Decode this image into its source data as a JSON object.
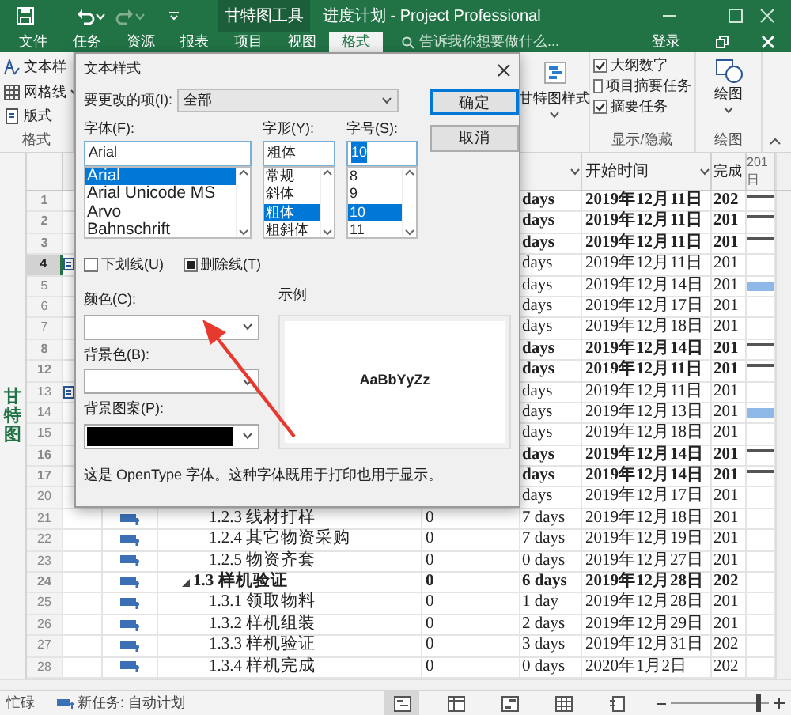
{
  "window": {
    "context_tab": "甘特图工具",
    "title": "进度计划 - Project Professional"
  },
  "ribbon_tabs": [
    {
      "label": "文件",
      "selected": false
    },
    {
      "label": "任务",
      "selected": false
    },
    {
      "label": "资源",
      "selected": false
    },
    {
      "label": "报表",
      "selected": false
    },
    {
      "label": "项目",
      "selected": false
    },
    {
      "label": "视图",
      "selected": false
    },
    {
      "label": "格式",
      "selected": true
    }
  ],
  "tell_me": {
    "placeholder": "告诉我你想要做什么..."
  },
  "sign_in": "登录",
  "ribbon": {
    "format_group": {
      "items": [
        {
          "kind": "text-style",
          "label": "文本样"
        },
        {
          "kind": "gridlines",
          "label": "网格线"
        },
        {
          "kind": "layout",
          "label": "版式"
        }
      ],
      "label": "格式"
    },
    "gantt_style": {
      "label": "甘特图样式"
    },
    "show_hide": {
      "items": [
        {
          "label": "大纲数字",
          "checked": true
        },
        {
          "label": "项目摘要任务",
          "checked": false
        },
        {
          "label": "摘要任务",
          "checked": true
        }
      ],
      "label": "显示/隐藏"
    },
    "drawing": {
      "label": "绘图",
      "group_label": "绘图"
    }
  },
  "side_label": "甘特图",
  "table": {
    "columns": [
      {
        "label": "开始时间"
      },
      {
        "label": "完成"
      }
    ],
    "timescale": {
      "year": "201",
      "day": "日"
    },
    "rows": [
      {
        "id": "1",
        "duration": "days",
        "start": "2019年12月11日",
        "finish": "202",
        "bold": true,
        "selected": false,
        "kind": "summary"
      },
      {
        "id": "2",
        "duration": "days",
        "start": "2019年12月11日",
        "finish": "201",
        "bold": true,
        "selected": false,
        "kind": "summary"
      },
      {
        "id": "3",
        "duration": "days",
        "start": "2019年12月11日",
        "finish": "201",
        "bold": true,
        "selected": false,
        "kind": "summary"
      },
      {
        "id": "4",
        "duration": "days",
        "start": "2019年12月11日",
        "finish": "201",
        "bold": false,
        "selected": true,
        "indicator": true
      },
      {
        "id": "5",
        "duration": "days",
        "start": "2019年12月14日",
        "finish": "201",
        "bold": false,
        "selected": false,
        "kind": "task"
      },
      {
        "id": "6",
        "duration": "days",
        "start": "2019年12月17日",
        "finish": "201",
        "bold": false,
        "selected": false
      },
      {
        "id": "7",
        "duration": "days",
        "start": "2019年12月18日",
        "finish": "201",
        "bold": false,
        "selected": false
      },
      {
        "id": "8",
        "duration": "days",
        "start": "2019年12月14日",
        "finish": "201",
        "bold": true,
        "selected": false,
        "kind": "summary"
      },
      {
        "id": "12",
        "duration": "days",
        "start": "2019年12月11日",
        "finish": "201",
        "bold": true,
        "selected": false,
        "kind": "summary"
      },
      {
        "id": "13",
        "duration": "days",
        "start": "2019年12月11日",
        "finish": "201",
        "bold": false,
        "selected": false,
        "indicator": true
      },
      {
        "id": "14",
        "duration": "days",
        "start": "2019年12月13日",
        "finish": "201",
        "bold": false,
        "selected": false,
        "kind": "task"
      },
      {
        "id": "15",
        "duration": "days",
        "start": "2019年12月18日",
        "finish": "201",
        "bold": false,
        "selected": false
      },
      {
        "id": "16",
        "duration": "days",
        "start": "2019年12月14日",
        "finish": "201",
        "bold": true,
        "selected": false,
        "kind": "summary"
      },
      {
        "id": "17",
        "duration": "days",
        "start": "2019年12月14日",
        "finish": "201",
        "bold": true,
        "selected": false,
        "kind": "summary"
      },
      {
        "id": "20",
        "duration": "days",
        "start": "2019年12月17日",
        "finish": "201",
        "bold": false,
        "selected": false
      },
      {
        "id": "21",
        "name": "1.2.3 线材打样",
        "work": "0",
        "duration": "7 days",
        "start": "2019年12月18日",
        "finish": "201",
        "bold": false,
        "selected": false
      },
      {
        "id": "22",
        "name": "1.2.4 其它物资采购",
        "work": "0",
        "duration": "7 days",
        "start": "2019年12月19日",
        "finish": "201",
        "bold": false,
        "selected": false
      },
      {
        "id": "23",
        "name": "1.2.5 物资齐套",
        "work": "0",
        "duration": "0 days",
        "start": "2019年12月27日",
        "finish": "201",
        "bold": false,
        "selected": false
      },
      {
        "id": "24",
        "name": "1.3 样机验证",
        "work": "0",
        "duration": "6 days",
        "start": "2019年12月28日",
        "finish": "202",
        "bold": true,
        "selected": false,
        "expanded": true,
        "children": [
          {
            "id": "25",
            "name": "1.3.1 领取物料",
            "work": "0",
            "duration": "1 day",
            "start": "2019年12月28日",
            "finish": "201",
            "bold": false,
            "selected": false
          },
          {
            "id": "26",
            "name": "1.3.2 样机组装",
            "work": "0",
            "duration": "2 days",
            "start": "2019年12月29日",
            "finish": "201",
            "bold": false,
            "selected": false
          },
          {
            "id": "27",
            "name": "1.3.3 样机验证",
            "work": "0",
            "duration": "3 days",
            "start": "2019年12月31日",
            "finish": "202",
            "bold": false,
            "selected": false
          },
          {
            "id": "28",
            "name": "1.3.4 样机完成",
            "work": "0",
            "duration": "0 days",
            "start": "2020年1月2日",
            "finish": "202",
            "bold": false,
            "selected": false
          }
        ]
      }
    ]
  },
  "status_bar": {
    "state": "忙碌",
    "task_mode": "新任务: 自动计划",
    "views": [
      {
        "kind": "gantt",
        "selected": true
      },
      {
        "kind": "usage",
        "selected": false
      },
      {
        "kind": "team",
        "selected": false
      },
      {
        "kind": "sheet",
        "selected": false
      },
      {
        "kind": "report",
        "selected": false
      }
    ],
    "zoom": {
      "level": 0.9
    }
  },
  "dialog": {
    "title": "文本样式",
    "item_to_change": {
      "label": "要更改的项(I):",
      "value": "全部"
    },
    "ok": "确定",
    "cancel": "取消",
    "font": {
      "label": "字体(F):",
      "value": "Arial",
      "options": [
        {
          "label": "Arial",
          "selected": true
        },
        {
          "label": "Arial Unicode MS",
          "selected": false
        },
        {
          "label": "Arvo",
          "selected": false
        },
        {
          "label": "Bahnschrift",
          "selected": false
        }
      ]
    },
    "style": {
      "label": "字形(Y):",
      "value": "粗体",
      "options": [
        {
          "label": "常规",
          "selected": false
        },
        {
          "label": "斜体",
          "selected": false
        },
        {
          "label": "粗体",
          "selected": true
        },
        {
          "label": "粗斜体",
          "selected": false
        }
      ]
    },
    "size": {
      "label": "字号(S):",
      "value": "10",
      "options": [
        {
          "label": "8",
          "selected": false
        },
        {
          "label": "9",
          "selected": false
        },
        {
          "label": "10",
          "selected": true
        },
        {
          "label": "11",
          "selected": false
        }
      ]
    },
    "underline": {
      "label": "下划线(U)",
      "checked": false
    },
    "strikethrough": {
      "label": "删除线(T)",
      "checked": true
    },
    "color": {
      "label": "颜色(C):"
    },
    "background_color": {
      "label": "背景色(B):"
    },
    "background_pattern": {
      "label": "背景图案(P):",
      "color": "#000000"
    },
    "sample": {
      "label": "示例",
      "text": "AaBbYyZz"
    },
    "note": "这是 OpenType 字体。这种字体既用于打印也用于显示。"
  }
}
